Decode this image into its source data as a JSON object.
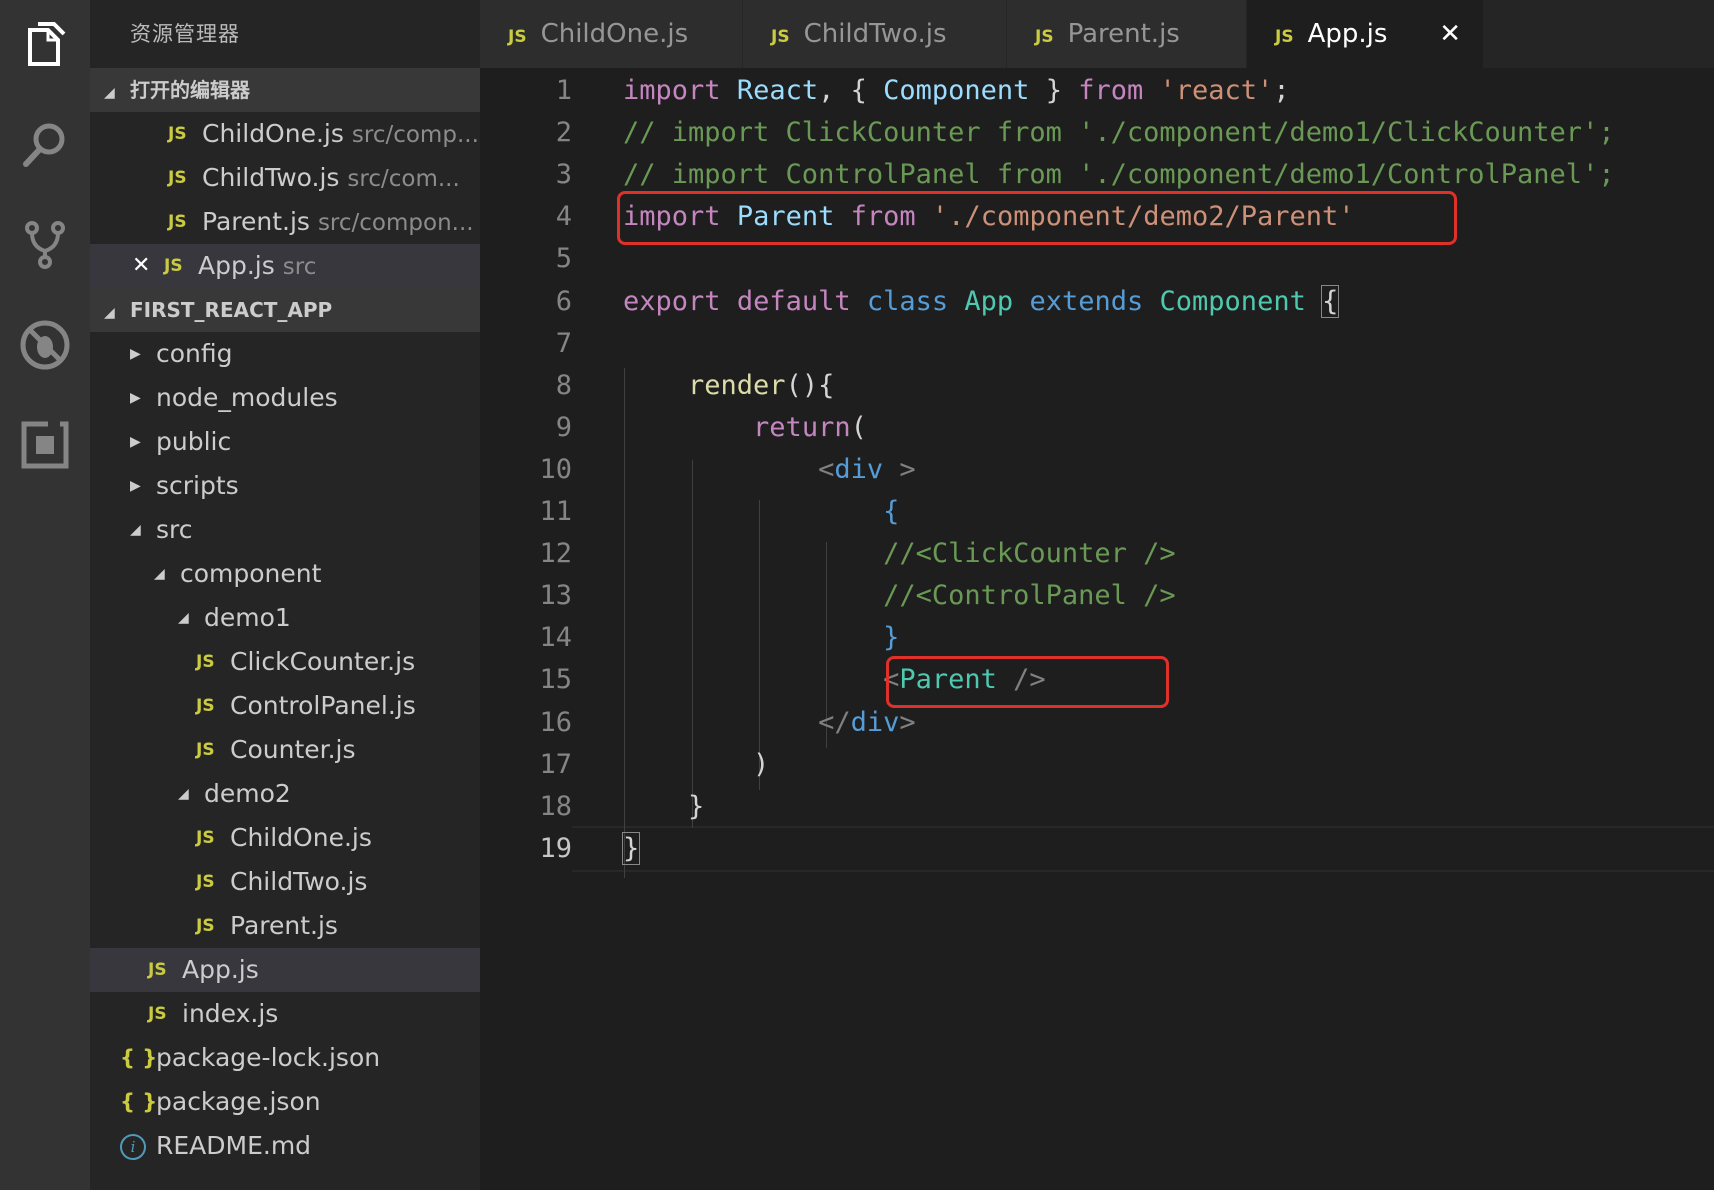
{
  "sidebar": {
    "title": "资源管理器",
    "open_editors": {
      "label": "打开的编辑器",
      "items": [
        {
          "name": "ChildOne.js",
          "path": "src/comp..."
        },
        {
          "name": "ChildTwo.js",
          "path": "src/com..."
        },
        {
          "name": "Parent.js",
          "path": "src/compon..."
        },
        {
          "name": "App.js",
          "path": "src"
        }
      ]
    },
    "project": {
      "label": "FIRST_REACT_APP",
      "items": [
        {
          "label": "config"
        },
        {
          "label": "node_modules"
        },
        {
          "label": "public"
        },
        {
          "label": "scripts"
        },
        {
          "label": "src"
        },
        {
          "label": "component"
        },
        {
          "label": "demo1"
        },
        {
          "label": "ClickCounter.js"
        },
        {
          "label": "ControlPanel.js"
        },
        {
          "label": "Counter.js"
        },
        {
          "label": "demo2"
        },
        {
          "label": "ChildOne.js"
        },
        {
          "label": "ChildTwo.js"
        },
        {
          "label": "Parent.js"
        },
        {
          "label": "App.js"
        },
        {
          "label": "index.js"
        },
        {
          "label": "package-lock.json"
        },
        {
          "label": "package.json"
        },
        {
          "label": "README.md"
        }
      ]
    }
  },
  "tabs": [
    {
      "label": "ChildOne.js"
    },
    {
      "label": "ChildTwo.js"
    },
    {
      "label": "Parent.js"
    },
    {
      "label": "App.js"
    }
  ],
  "file_badge": "JS",
  "json_badge": "{ }",
  "info_badge": "i",
  "close_glyph": "✕",
  "editor": {
    "current_line": "19",
    "lines": [
      {
        "n": "1",
        "tokens": [
          [
            "kw",
            "import"
          ],
          [
            "pn",
            " "
          ],
          [
            "vr",
            "React"
          ],
          [
            "pn",
            ", { "
          ],
          [
            "vr",
            "Component"
          ],
          [
            "pn",
            " } "
          ],
          [
            "kw",
            "from"
          ],
          [
            "pn",
            " "
          ],
          [
            "st",
            "'react'"
          ],
          [
            "pn",
            ";"
          ]
        ]
      },
      {
        "n": "2",
        "tokens": [
          [
            "cm",
            "// import ClickCounter from './component/demo1/ClickCounter';"
          ]
        ]
      },
      {
        "n": "3",
        "tokens": [
          [
            "cm",
            "// import ControlPanel from './component/demo1/ControlPanel';"
          ]
        ]
      },
      {
        "n": "4",
        "tokens": [
          [
            "kw",
            "import"
          ],
          [
            "pn",
            " "
          ],
          [
            "vr",
            "Parent"
          ],
          [
            "pn",
            " "
          ],
          [
            "kw",
            "from"
          ],
          [
            "pn",
            " "
          ],
          [
            "st",
            "'./component/demo2/Parent'"
          ]
        ]
      },
      {
        "n": "5",
        "tokens": []
      },
      {
        "n": "6",
        "tokens": [
          [
            "kw",
            "export"
          ],
          [
            "pn",
            " "
          ],
          [
            "kw",
            "default"
          ],
          [
            "pn",
            " "
          ],
          [
            "bl",
            "class"
          ],
          [
            "pn",
            " "
          ],
          [
            "ty",
            "App"
          ],
          [
            "pn",
            " "
          ],
          [
            "bl",
            "extends"
          ],
          [
            "pn",
            " "
          ],
          [
            "ty",
            "Component"
          ],
          [
            "pn",
            " "
          ],
          [
            "pn",
            "{"
          ]
        ]
      },
      {
        "n": "7",
        "tokens": []
      },
      {
        "n": "8",
        "tokens": [
          [
            "pn",
            "    "
          ],
          [
            "fn",
            "render"
          ],
          [
            "pn",
            "(){"
          ]
        ]
      },
      {
        "n": "9",
        "tokens": [
          [
            "pn",
            "        "
          ],
          [
            "kw",
            "return"
          ],
          [
            "pn",
            "("
          ]
        ]
      },
      {
        "n": "10",
        "tokens": [
          [
            "pn",
            "            "
          ],
          [
            "gr",
            "<"
          ],
          [
            "bl",
            "div"
          ],
          [
            "pn",
            " "
          ],
          [
            "gr",
            ">"
          ]
        ]
      },
      {
        "n": "11",
        "tokens": [
          [
            "pn",
            "                "
          ],
          [
            "bl",
            "{"
          ]
        ]
      },
      {
        "n": "12",
        "tokens": [
          [
            "pn",
            "                "
          ],
          [
            "cm",
            "//<ClickCounter />"
          ]
        ]
      },
      {
        "n": "13",
        "tokens": [
          [
            "pn",
            "                "
          ],
          [
            "cm",
            "//<ControlPanel />"
          ]
        ]
      },
      {
        "n": "14",
        "tokens": [
          [
            "pn",
            "                "
          ],
          [
            "bl",
            "}"
          ]
        ]
      },
      {
        "n": "15",
        "tokens": [
          [
            "pn",
            "                "
          ],
          [
            "gr",
            "<"
          ],
          [
            "ty",
            "Parent"
          ],
          [
            "pn",
            " "
          ],
          [
            "gr",
            "/>"
          ]
        ]
      },
      {
        "n": "16",
        "tokens": [
          [
            "pn",
            "            "
          ],
          [
            "gr",
            "</"
          ],
          [
            "bl",
            "div"
          ],
          [
            "gr",
            ">"
          ]
        ]
      },
      {
        "n": "17",
        "tokens": [
          [
            "pn",
            "        )"
          ]
        ]
      },
      {
        "n": "18",
        "tokens": [
          [
            "pn",
            "    }"
          ]
        ]
      },
      {
        "n": "19",
        "tokens": [
          [
            "pn",
            "}"
          ]
        ]
      }
    ]
  }
}
